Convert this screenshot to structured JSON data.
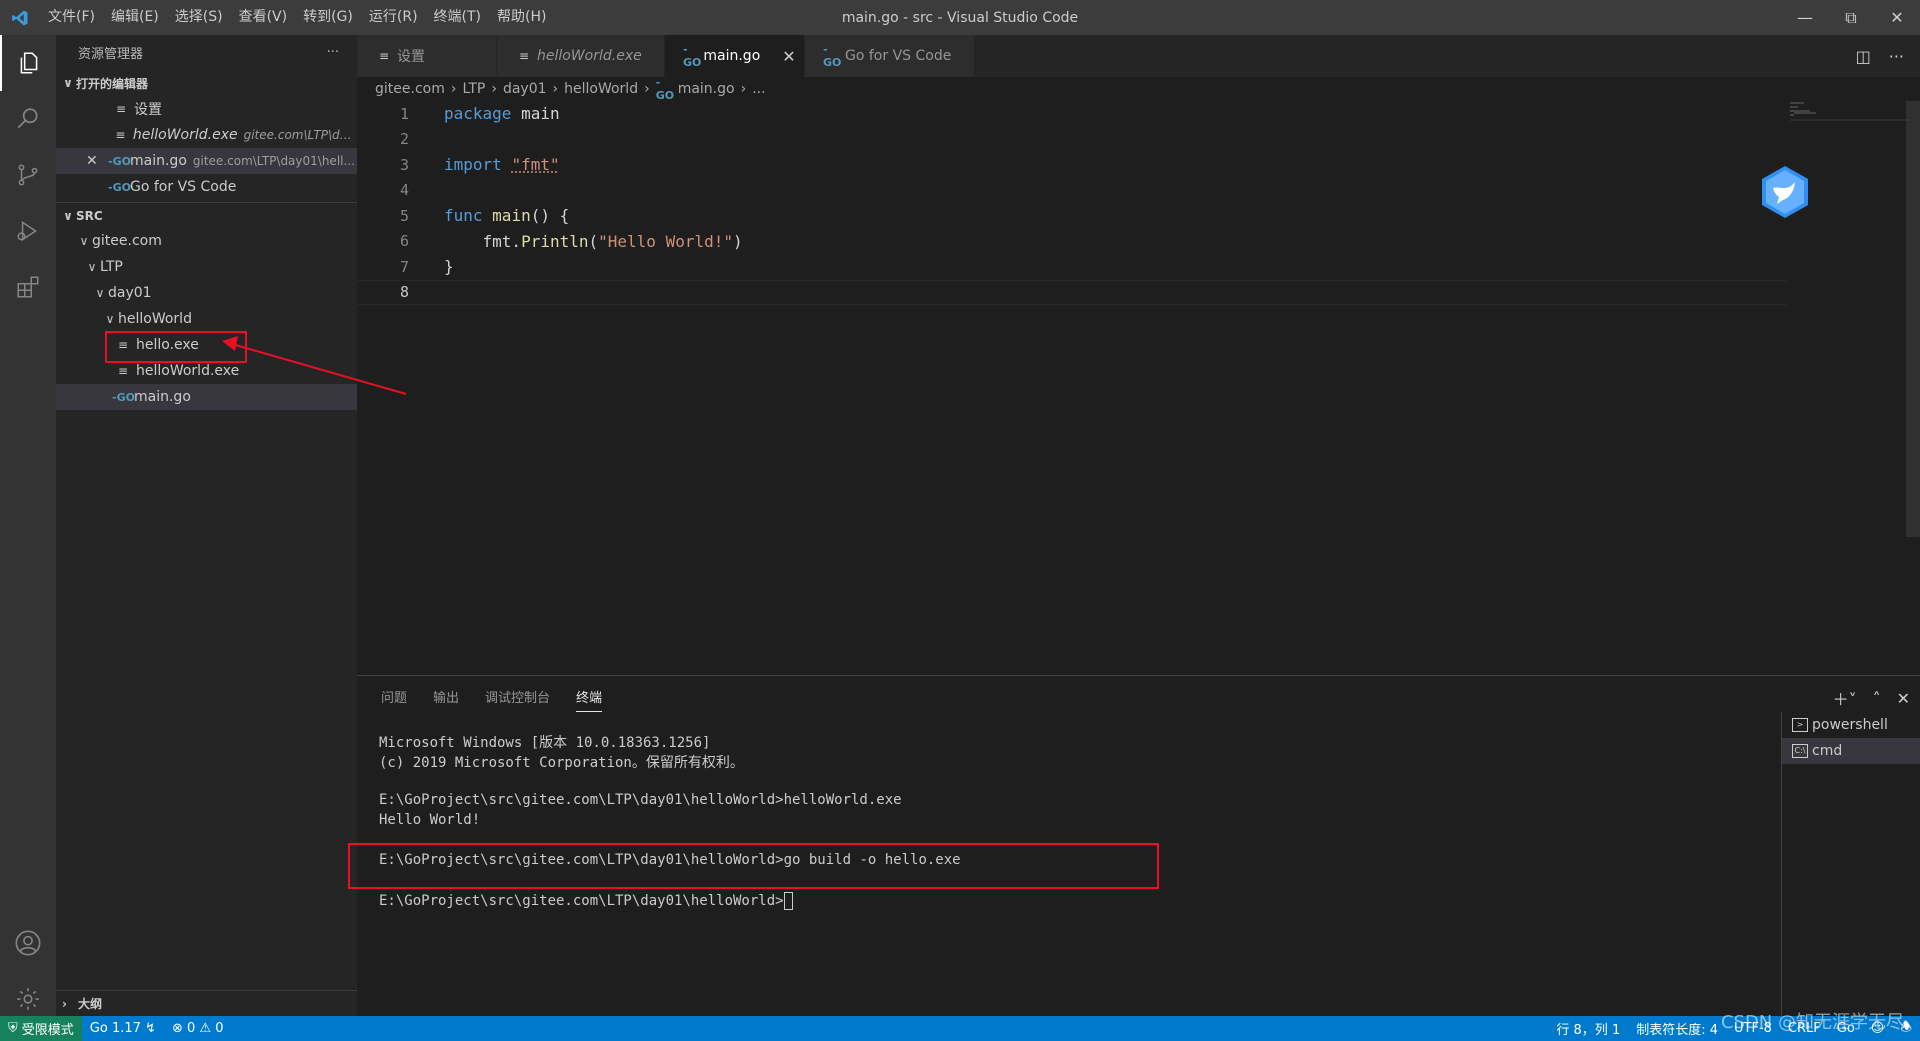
{
  "titlebar": {
    "menu": [
      "文件(F)",
      "编辑(E)",
      "选择(S)",
      "查看(V)",
      "转到(G)",
      "运行(R)",
      "终端(T)",
      "帮助(H)"
    ],
    "title": "main.go - src - Visual Studio Code"
  },
  "sidebar": {
    "header": "资源管理器",
    "more": "···",
    "open_editors": {
      "section": "打开的编辑器",
      "items": [
        {
          "label": "设置",
          "desc": ""
        },
        {
          "label": "helloWorld.exe",
          "desc": "gitee.com\\LTP\\day..."
        },
        {
          "label": "main.go",
          "desc": "gitee.com\\LTP\\day01\\hell..."
        },
        {
          "label": "Go for VS Code",
          "desc": ""
        }
      ]
    },
    "folder": {
      "section": "SRC",
      "tree": [
        "gitee.com",
        "LTP",
        "day01",
        "helloWorld",
        "hello.exe",
        "helloWorld.exe",
        "main.go"
      ]
    },
    "outline": "大纲"
  },
  "tabs": [
    {
      "label": "设置"
    },
    {
      "label": "helloWorld.exe"
    },
    {
      "label": "main.go"
    },
    {
      "label": "Go for VS Code"
    }
  ],
  "breadcrumb": [
    "gitee.com",
    "LTP",
    "day01",
    "helloWorld",
    "main.go",
    "..."
  ],
  "editor": {
    "line_numbers": [
      "1",
      "2",
      "3",
      "4",
      "5",
      "6",
      "7",
      "8"
    ],
    "code": {
      "l1_kw": "package",
      "l1_rest": " main",
      "l3_kw": "import",
      "l3_str": "\"fmt\"",
      "l5_kw": "func",
      "l5_fn": "main",
      "l5_rest": "() {",
      "l6_pre": "    fmt.",
      "l6_fn": "Println",
      "l6_open": "(",
      "l6_str": "\"Hello World!\"",
      "l6_close": ")",
      "l7": "}"
    }
  },
  "panel": {
    "tabs": [
      "问题",
      "输出",
      "调试控制台",
      "终端"
    ],
    "terminal_lines": [
      "Microsoft Windows [版本 10.0.18363.1256]",
      "(c) 2019 Microsoft Corporation。保留所有权利。",
      "",
      "E:\\GoProject\\src\\gitee.com\\LTP\\day01\\helloWorld>helloWorld.exe",
      "Hello World!",
      "",
      "E:\\GoProject\\src\\gitee.com\\LTP\\day01\\helloWorld>go build -o hello.exe",
      "",
      "E:\\GoProject\\src\\gitee.com\\LTP\\day01\\helloWorld>"
    ],
    "terminals": [
      "powershell",
      "cmd"
    ]
  },
  "statusbar": {
    "restricted": "受限模式",
    "go_version": "Go 1.17",
    "errors": "0",
    "warnings": "0",
    "position": "行 8，列 1",
    "tab_size": "制表符长度: 4",
    "encoding": "UTF-8",
    "eol": "CRLF",
    "language": "Go"
  },
  "watermark": "CSDN @知无涯学无尽",
  "colors": {
    "accent": "#007acc",
    "annotation": "#e81123",
    "go_icon": "#519aba"
  }
}
